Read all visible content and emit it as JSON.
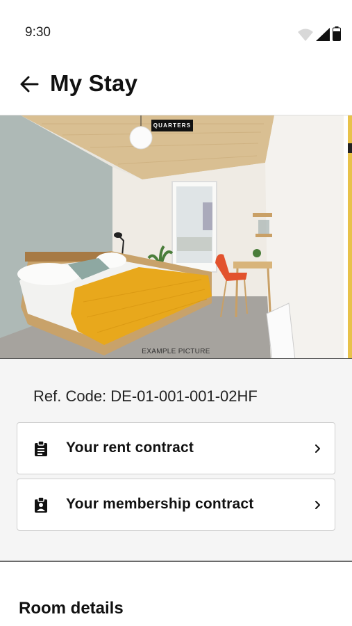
{
  "status_bar": {
    "time": "9:30",
    "icons": [
      "wifi-icon",
      "cellular-signal-icon",
      "battery-icon"
    ]
  },
  "header": {
    "title": "My Stay",
    "back_icon": "arrow-left-icon"
  },
  "photo": {
    "brand_badge": "QUARTERS",
    "caption": "EXAMPLE PICTURE"
  },
  "details": {
    "ref_code": "Ref. Code: DE-01-001-001-02HF",
    "contracts": [
      {
        "label": "Your rent contract",
        "icon": "clipboard-list-icon"
      },
      {
        "label": "Your membership contract",
        "icon": "clipboard-account-icon"
      }
    ]
  },
  "room": {
    "heading": "Room details"
  },
  "colors": {
    "blanket": "#E8A81C",
    "wall": "#AEB9B6",
    "background": "#F5F5F5"
  }
}
